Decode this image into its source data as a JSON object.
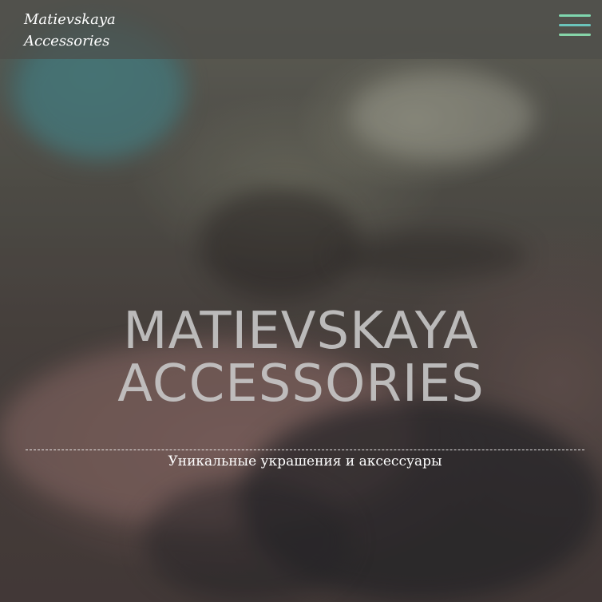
{
  "header": {
    "logo_line1": "Matievskaya",
    "logo_line2": "Accessories",
    "menu_icon": "hamburger-menu-icon"
  },
  "hero": {
    "title_line1": "MATIEVSKAYA",
    "title_line2": "ACCESSORIES",
    "tagline": "Уникальные украшения и аксессуары"
  },
  "colors": {
    "menu_bar_top": "#7fd6ae",
    "menu_bar_middle": "#6bc4bb",
    "menu_bar_bottom": "#86d4a8",
    "title_color": "#c8c8c8",
    "text_white": "#ffffff"
  }
}
